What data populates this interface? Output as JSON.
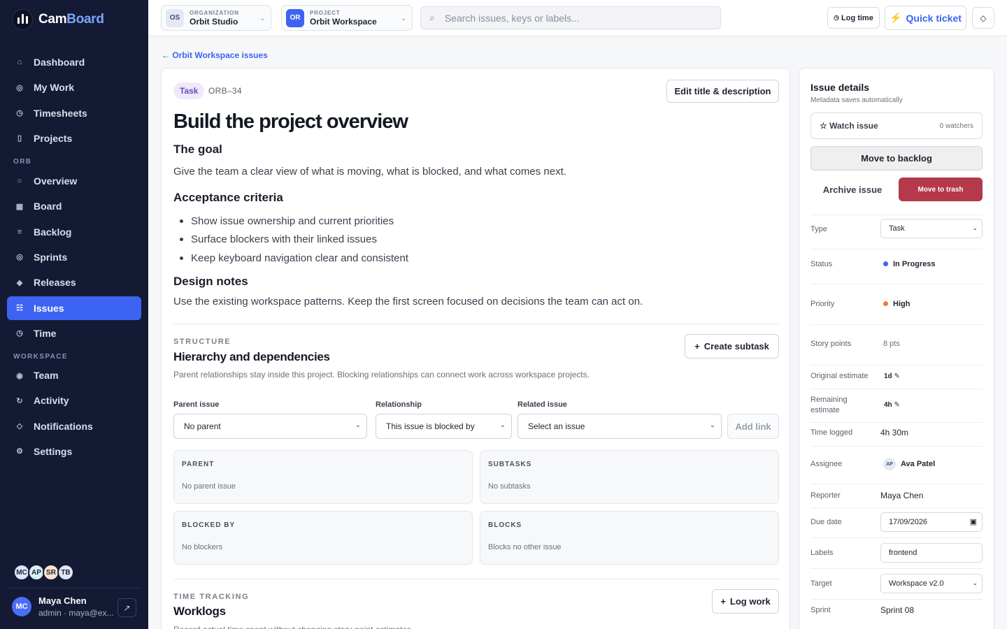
{
  "app": {
    "name_part1": "Cam",
    "name_part2": "Board"
  },
  "sidebar": {
    "items": [
      {
        "label": "Dashboard",
        "icon": "home-icon",
        "glyph": "⌂"
      },
      {
        "label": "My Work",
        "icon": "target-icon",
        "glyph": "◎"
      },
      {
        "label": "Timesheets",
        "icon": "clock-icon",
        "glyph": "◷"
      },
      {
        "label": "Projects",
        "icon": "folder-icon",
        "glyph": "▯"
      }
    ],
    "section_orb": "ORB",
    "orb_items": [
      {
        "label": "Overview",
        "icon": "overview-icon",
        "glyph": "○"
      },
      {
        "label": "Board",
        "icon": "board-icon",
        "glyph": "▦"
      },
      {
        "label": "Backlog",
        "icon": "backlog-icon",
        "glyph": "≡"
      },
      {
        "label": "Sprints",
        "icon": "sprint-icon",
        "glyph": "◎"
      },
      {
        "label": "Releases",
        "icon": "release-icon",
        "glyph": "◆"
      },
      {
        "label": "Issues",
        "icon": "issues-icon",
        "glyph": "☷",
        "active": true
      },
      {
        "label": "Time",
        "icon": "time-icon",
        "glyph": "◷"
      }
    ],
    "section_workspace": "WORKSPACE",
    "workspace_items": [
      {
        "label": "Team",
        "icon": "team-icon",
        "glyph": "◉"
      },
      {
        "label": "Activity",
        "icon": "activity-icon",
        "glyph": "↻"
      },
      {
        "label": "Notifications",
        "icon": "bell-icon",
        "glyph": "◇"
      },
      {
        "label": "Settings",
        "icon": "gear-icon",
        "glyph": "⚙"
      }
    ],
    "avatars": [
      {
        "initials": "MC",
        "color": "#dbe4ff"
      },
      {
        "initials": "AP",
        "color": "#d5f0f5"
      },
      {
        "initials": "SR",
        "color": "#fde2cf"
      },
      {
        "initials": "TB",
        "color": "#e1e4f5"
      }
    ],
    "user": {
      "initials": "MC",
      "name": "Maya Chen",
      "subtitle": "admin · maya@ex..."
    }
  },
  "topbar": {
    "org_badge": "OS",
    "org_label": "ORGANIZATION",
    "org_value": "Orbit Studio",
    "crumb_sep": "/",
    "project_badge": "OR",
    "project_label": "PROJECT",
    "project_value": "Orbit Workspace",
    "search_placeholder": "Search issues, keys or labels...",
    "log_time": "Log time",
    "quick_ticket": "Quick ticket"
  },
  "issue": {
    "back_link": "← Orbit Workspace issues",
    "type": "Task",
    "key": "ORB–34",
    "edit_button": "Edit title & description",
    "title": "Build the project overview",
    "goal_heading": "The goal",
    "goal_text": "Give the team a clear view of what is moving, what is blocked, and what comes next.",
    "criteria_heading": "Acceptance criteria",
    "criteria": [
      "Show issue ownership and current priorities",
      "Surface blockers with their linked issues",
      "Keep keyboard navigation clear and consistent"
    ],
    "notes_heading": "Design notes",
    "notes_text": "Use the existing workspace patterns. Keep the first screen focused on decisions the team can act on."
  },
  "structure": {
    "eyebrow": "STRUCTURE",
    "title": "Hierarchy and dependencies",
    "description": "Parent relationships stay inside this project. Blocking relationships can connect work across workspace projects.",
    "create_subtask": "Create subtask",
    "parent_label": "Parent issue",
    "parent_value": "No parent",
    "relationship_label": "Relationship",
    "relationship_value": "This issue is blocked by",
    "related_label": "Related issue",
    "related_value": "Select an issue",
    "add_link": "Add link",
    "boxes": {
      "parent": {
        "title": "PARENT",
        "empty": "No parent issue"
      },
      "subtasks": {
        "title": "SUBTASKS",
        "empty": "No subtasks"
      },
      "blocked_by": {
        "title": "BLOCKED BY",
        "empty": "No blockers"
      },
      "blocks": {
        "title": "BLOCKS",
        "empty": "Blocks no other issue"
      }
    }
  },
  "time_tracking": {
    "eyebrow": "TIME TRACKING",
    "title": "Worklogs",
    "description": "Record actual time spent without changing story-point estimates.",
    "log_work": "Log work"
  },
  "details": {
    "title": "Issue details",
    "subtitle": "Metadata saves automatically",
    "watch": "Watch issue",
    "watchers": "0 watchers",
    "move_backlog": "Move to backlog",
    "archive": "Archive issue",
    "trash": "Move to trash",
    "type_label": "Type",
    "type_value": "Task",
    "status_label": "Status",
    "status_value": "In Progress",
    "status_color": "#3d63f2",
    "priority_label": "Priority",
    "priority_value": "High",
    "priority_color": "#f07c3a",
    "points_label": "Story points",
    "points_value": "8 pts",
    "orig_label": "Original estimate",
    "orig_value": "1d",
    "remaining_label_1": "Remaining",
    "remaining_label_2": "estimate",
    "remaining_value": "4h",
    "logged_label": "Time logged",
    "logged_value": "4h 30m",
    "assignee_label": "Assignee",
    "assignee_initials": "AP",
    "assignee_value": "Ava Patel",
    "reporter_label": "Reporter",
    "reporter_value": "Maya Chen",
    "due_label": "Due date",
    "due_value": "17/09/2026",
    "labels_label": "Labels",
    "labels_value": "frontend",
    "target_label": "Target",
    "target_value": "Workspace v2.0",
    "sprint_label": "Sprint",
    "sprint_value": "Sprint 08"
  }
}
